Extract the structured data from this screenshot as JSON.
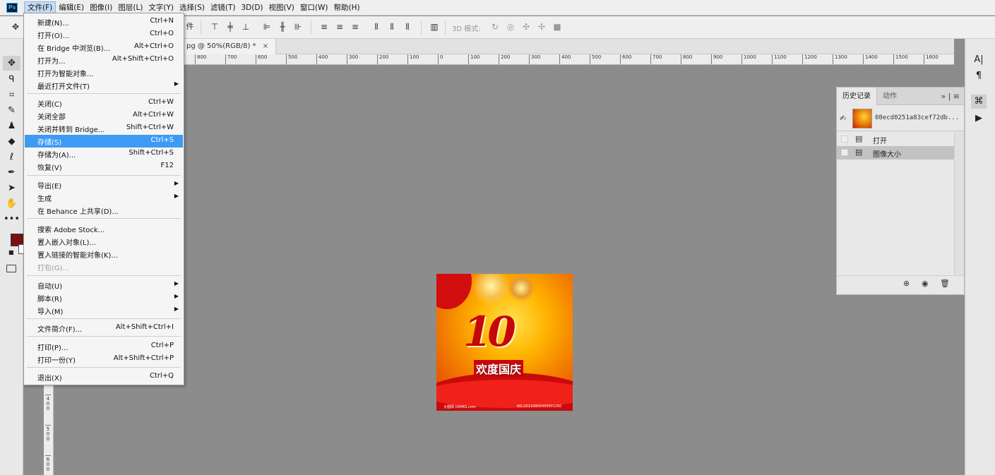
{
  "menubar": {
    "logo": "Ps",
    "items": [
      {
        "label": "文件(F)",
        "active": true
      },
      {
        "label": "编辑(E)"
      },
      {
        "label": "图像(I)"
      },
      {
        "label": "图层(L)"
      },
      {
        "label": "文字(Y)"
      },
      {
        "label": "选择(S)"
      },
      {
        "label": "滤镜(T)"
      },
      {
        "label": "3D(D)"
      },
      {
        "label": "视图(V)"
      },
      {
        "label": "窗口(W)"
      },
      {
        "label": "帮助(H)"
      }
    ]
  },
  "options_bar": {
    "partial_text": "件",
    "mode_3d_label": "3D 模式:"
  },
  "document_tab": {
    "title": "pg @ 50%(RGB/8) *",
    "close": "×"
  },
  "ruler_top": [
    "800",
    "700",
    "600",
    "500",
    "400",
    "300",
    "200",
    "100",
    "0",
    "100",
    "200",
    "300",
    "400",
    "500",
    "600",
    "700",
    "800",
    "900",
    "1000",
    "1100",
    "1200",
    "1300",
    "1400",
    "1500",
    "1600"
  ],
  "ruler_left": [
    "4\n0\n0",
    "5\n0\n0",
    "6\n0\n0"
  ],
  "colors": {
    "foreground": "#7a1010",
    "background": "#ffffff",
    "menu_highlight": "#3d9bf5"
  },
  "image": {
    "number_text": "10",
    "title": "欢度国庆",
    "footer_left": "大图网 DAIMG.com",
    "footer_right": "NO:20110905000001260"
  },
  "file_menu": {
    "items": [
      {
        "label": "新建(N)...",
        "shortcut": "Ctrl+N"
      },
      {
        "label": "打开(O)...",
        "shortcut": "Ctrl+O"
      },
      {
        "label": "在 Bridge 中浏览(B)...",
        "shortcut": "Alt+Ctrl+O"
      },
      {
        "label": "打开为...",
        "shortcut": "Alt+Shift+Ctrl+O"
      },
      {
        "label": "打开为智能对象..."
      },
      {
        "label": "最近打开文件(T)",
        "submenu": true
      },
      {
        "separator": true
      },
      {
        "label": "关闭(C)",
        "shortcut": "Ctrl+W"
      },
      {
        "label": "关闭全部",
        "shortcut": "Alt+Ctrl+W"
      },
      {
        "label": "关闭并转到 Bridge...",
        "shortcut": "Shift+Ctrl+W"
      },
      {
        "label": "存储(S)",
        "shortcut": "Ctrl+S",
        "highlighted": true
      },
      {
        "label": "存储为(A)...",
        "shortcut": "Shift+Ctrl+S"
      },
      {
        "label": "恢复(V)",
        "shortcut": "F12"
      },
      {
        "separator": true
      },
      {
        "label": "导出(E)",
        "submenu": true
      },
      {
        "label": "生成",
        "submenu": true
      },
      {
        "label": "在 Behance 上共享(D)..."
      },
      {
        "separator": true
      },
      {
        "label": "搜索 Adobe Stock..."
      },
      {
        "label": "置入嵌入对象(L)..."
      },
      {
        "label": "置入链接的智能对象(K)..."
      },
      {
        "label": "打包(G)...",
        "disabled": true
      },
      {
        "separator": true
      },
      {
        "label": "自动(U)",
        "submenu": true
      },
      {
        "label": "脚本(R)",
        "submenu": true
      },
      {
        "label": "导入(M)",
        "submenu": true
      },
      {
        "separator": true
      },
      {
        "label": "文件简介(F)...",
        "shortcut": "Alt+Shift+Ctrl+I"
      },
      {
        "separator": true
      },
      {
        "label": "打印(P)...",
        "shortcut": "Ctrl+P"
      },
      {
        "label": "打印一份(Y)",
        "shortcut": "Alt+Shift+Ctrl+P"
      },
      {
        "separator": true
      },
      {
        "label": "退出(X)",
        "shortcut": "Ctrl+Q"
      }
    ]
  },
  "history_panel": {
    "tabs": [
      {
        "label": "历史记录",
        "active": true
      },
      {
        "label": "动作"
      }
    ],
    "collapse_icon": "»",
    "snapshot_name": "08ecd0251a83cef72db...",
    "rows": [
      {
        "label": "打开",
        "selected": false
      },
      {
        "label": "图像大小",
        "selected": true
      }
    ]
  },
  "right_dock": {
    "icons": [
      "character-icon",
      "paragraph-icon",
      "history-icon",
      "play-icon"
    ]
  }
}
